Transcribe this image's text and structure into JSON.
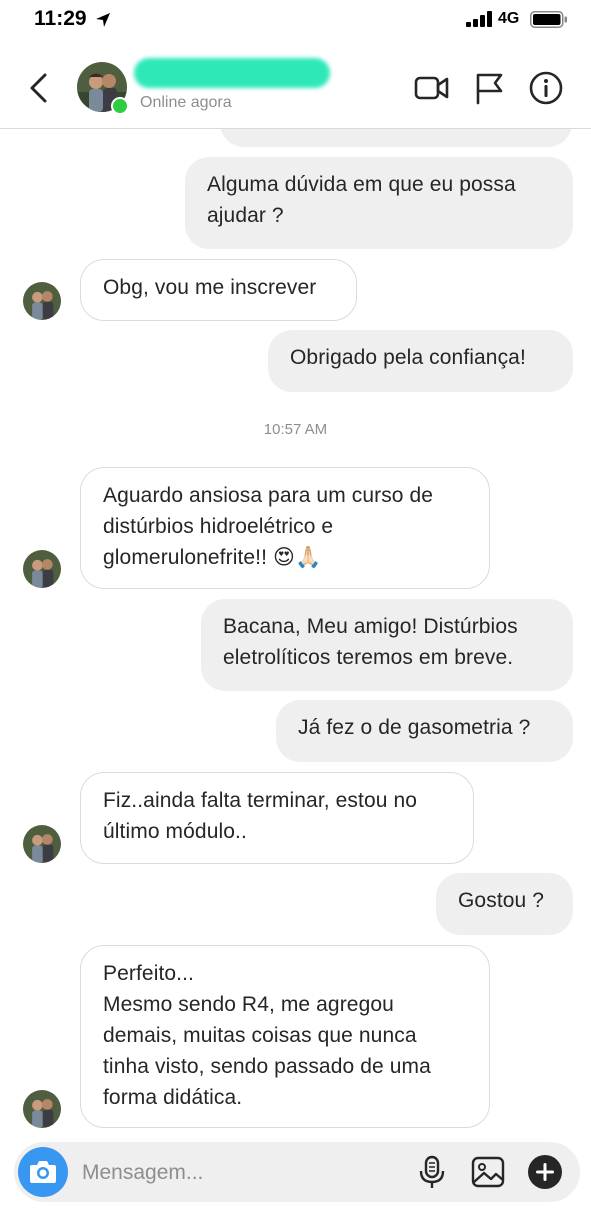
{
  "status_bar": {
    "time": "11:29",
    "network": "4G"
  },
  "header": {
    "contact_name": "",
    "status": "Online agora",
    "icons": [
      "back-icon",
      "video-call-icon",
      "flag-icon",
      "info-icon"
    ]
  },
  "messages": [
    {
      "side": "out",
      "text": "Alguma dúvida em que eu possa\najudar ?"
    },
    {
      "side": "in",
      "text": "Obg, vou me inscrever"
    },
    {
      "side": "out",
      "text": "Obrigado pela confiança!"
    },
    {
      "side": "in",
      "text": "Aguardo ansiosa para um curso de\ndistúrbios hidroelétrico e\nglomerulonefrite!! 😍🙏🏻"
    },
    {
      "side": "out",
      "text": "Bacana, Meu amigo! Distúrbios\neletrolíticos teremos em breve."
    },
    {
      "side": "out",
      "text": "Já fez o de gasometria ?"
    },
    {
      "side": "in",
      "text": "Fiz..ainda falta terminar, estou no\núltimo módulo.."
    },
    {
      "side": "out",
      "text": "Gostou ?"
    },
    {
      "side": "in",
      "text": "Perfeito...\nMesmo sendo R4, me agregou\ndemais, muitas coisas que nunca\ntinha visto, sendo passado de uma\nforma didática."
    }
  ],
  "timestamp": "10:57 AM",
  "composer": {
    "placeholder": "Mensagem..."
  },
  "colors": {
    "accent": "#3897f0",
    "online": "#2ecc40",
    "bubble_out": "#efefef",
    "redaction": "#2ee8b8"
  }
}
